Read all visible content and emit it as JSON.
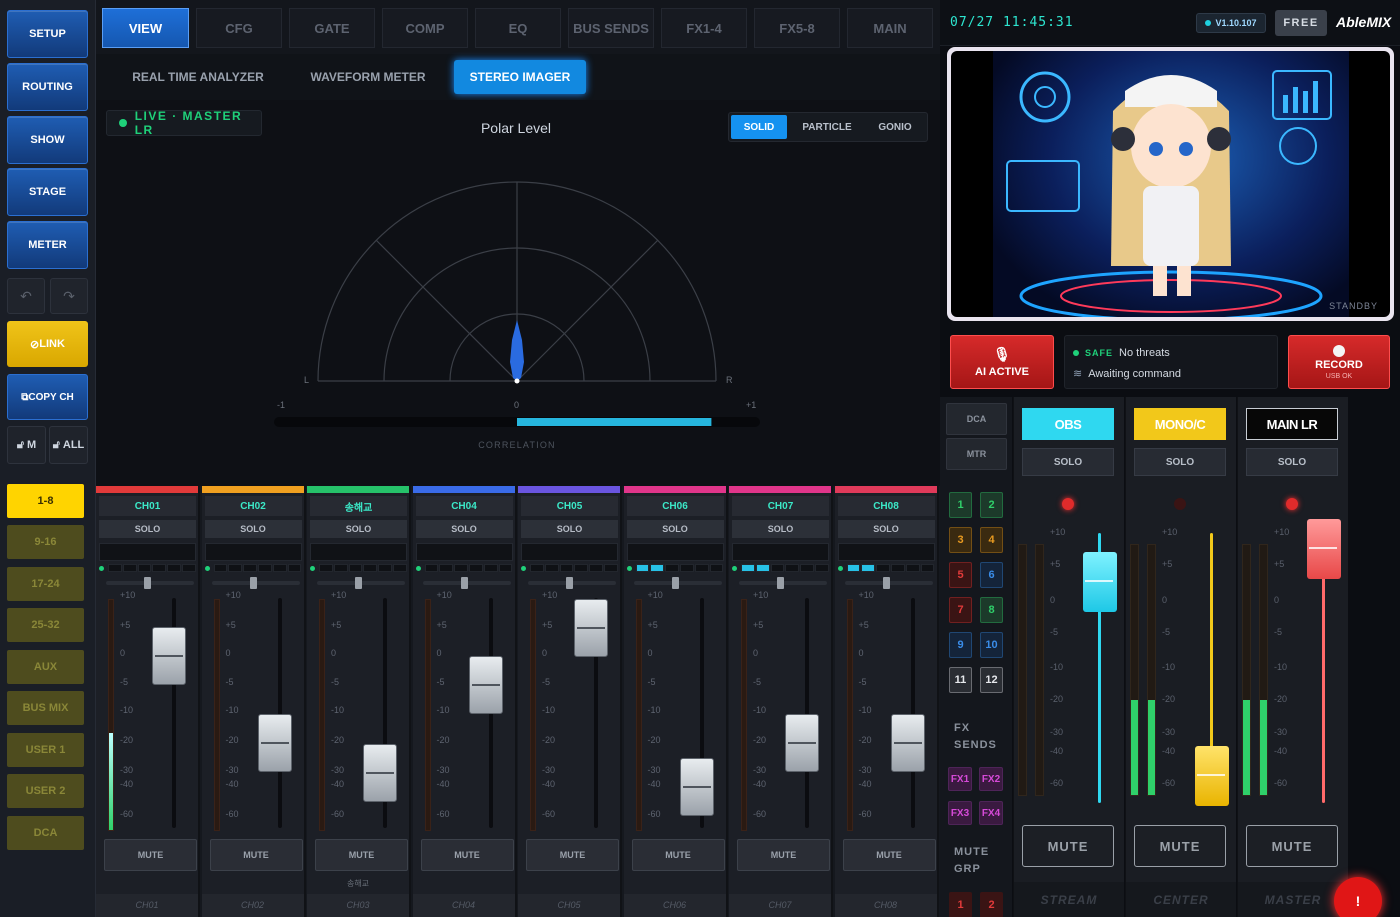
{
  "sidebar": {
    "nav": [
      "SETUP",
      "ROUTING",
      "SHOW",
      "STAGE",
      "METER"
    ],
    "undo_icon": "undo-icon",
    "redo_icon": "redo-icon",
    "link": "LINK",
    "copy_ch": "COPY CH",
    "lock_m": "M",
    "lock_all": "ALL",
    "banks": [
      "1-8",
      "9-16",
      "17-24",
      "25-32",
      "AUX",
      "BUS MIX",
      "USER 1",
      "USER 2",
      "DCA"
    ],
    "active_bank": "1-8"
  },
  "tabs": [
    "VIEW",
    "CFG",
    "GATE",
    "COMP",
    "EQ",
    "BUS SENDS",
    "FX1-4",
    "FX5-8",
    "MAIN"
  ],
  "active_tab": "VIEW",
  "subtabs": [
    "REAL TIME ANALYZER",
    "WAVEFORM METER",
    "STEREO IMAGER"
  ],
  "active_subtab": "STEREO IMAGER",
  "imager": {
    "live_label": "LIVE · MASTER LR",
    "title": "Polar Level",
    "modes": [
      "SOLID",
      "PARTICLE",
      "GONIO"
    ],
    "active_mode": "SOLID",
    "left_label": "L",
    "right_label": "R",
    "corr_min": "-1",
    "corr_mid": "0",
    "corr_max": "+1",
    "correlation_label": "CORRELATION",
    "correlation_value": 0.5
  },
  "channels": [
    {
      "name": "CH01",
      "solo": "SOLO",
      "mute": "MUTE",
      "foot": "CH01",
      "color": "#e23a3a",
      "fader_db": "0",
      "meter": 0.42,
      "dyn": 0
    },
    {
      "name": "CH02",
      "solo": "SOLO",
      "mute": "MUTE",
      "foot": "CH02",
      "color": "#f0a020",
      "fader_db": "-20",
      "meter": 0,
      "dyn": 0
    },
    {
      "name": "송해교",
      "solo": "SOLO",
      "mute": "MUTE",
      "foot": "CH03",
      "sub": "송해교",
      "color": "#26c26a",
      "fader_db": "-30",
      "meter": 0,
      "dyn": 0
    },
    {
      "name": "CH04",
      "solo": "SOLO",
      "mute": "MUTE",
      "foot": "CH04",
      "color": "#3a6be8",
      "fader_db": "-5",
      "meter": 0,
      "dyn": 0
    },
    {
      "name": "CH05",
      "solo": "SOLO",
      "mute": "MUTE",
      "foot": "CH05",
      "color": "#6a55e0",
      "fader_db": "+5",
      "meter": 0,
      "dyn": 0
    },
    {
      "name": "CH06",
      "solo": "SOLO",
      "mute": "MUTE",
      "foot": "CH06",
      "color": "#e0358a",
      "fader_db": "-40",
      "meter": 0,
      "dyn": 0.33
    },
    {
      "name": "CH07",
      "solo": "SOLO",
      "mute": "MUTE",
      "foot": "CH07",
      "color": "#e0358a",
      "fader_db": "-20",
      "meter": 0,
      "dyn": 0.33
    },
    {
      "name": "CH08",
      "solo": "SOLO",
      "mute": "MUTE",
      "foot": "CH08",
      "color": "#e03a5a",
      "fader_db": "-20",
      "meter": 0,
      "dyn": 0.33
    }
  ],
  "scale_labels": [
    "+10",
    "+5",
    "0",
    "-5",
    "-10",
    "-20",
    "-30",
    "-40",
    "-60"
  ],
  "header": {
    "clock": "07/27  11:45:31",
    "version": "V1.10.107",
    "plan": "FREE",
    "brand": "AbleMIX"
  },
  "preview": {
    "status": "STANDBY"
  },
  "ai_button": "AI ACTIVE",
  "status": {
    "safe": "SAFE",
    "threat": "No threats",
    "command": "Awaiting command"
  },
  "record": {
    "label": "RECORD",
    "sub": "USB OK"
  },
  "dca": {
    "buttons": [
      "DCA",
      "MTR"
    ],
    "numbers": [
      "1",
      "2",
      "3",
      "4",
      "5",
      "6",
      "7",
      "8",
      "9",
      "10",
      "11",
      "12"
    ],
    "fx_label_1": "FX",
    "fx_label_2": "SENDS",
    "fx": [
      "FX1",
      "FX2",
      "FX3",
      "FX4"
    ],
    "mute_label_1": "MUTE",
    "mute_label_2": "GRP",
    "mute_groups": [
      "1",
      "2"
    ]
  },
  "buses": [
    {
      "name": "OBS",
      "solo": "SOLO",
      "mute": "MUTE",
      "foot": "STREAM",
      "color": "#2fd8f0",
      "led": "#e02b2b"
    },
    {
      "name": "MONO/C",
      "solo": "SOLO",
      "mute": "MUTE",
      "foot": "CENTER",
      "color": "#f2c81a",
      "led": "#3a1414"
    },
    {
      "name": "MAIN LR",
      "solo": "SOLO",
      "mute": "MUTE",
      "foot": "MASTER",
      "color": "#ff6a6a",
      "led": "#e02b2b"
    }
  ],
  "bus_scale": [
    "+10",
    "+5",
    "0",
    "-5",
    "-10",
    "-20",
    "-30",
    "-40",
    "-60"
  ],
  "alert": "!"
}
